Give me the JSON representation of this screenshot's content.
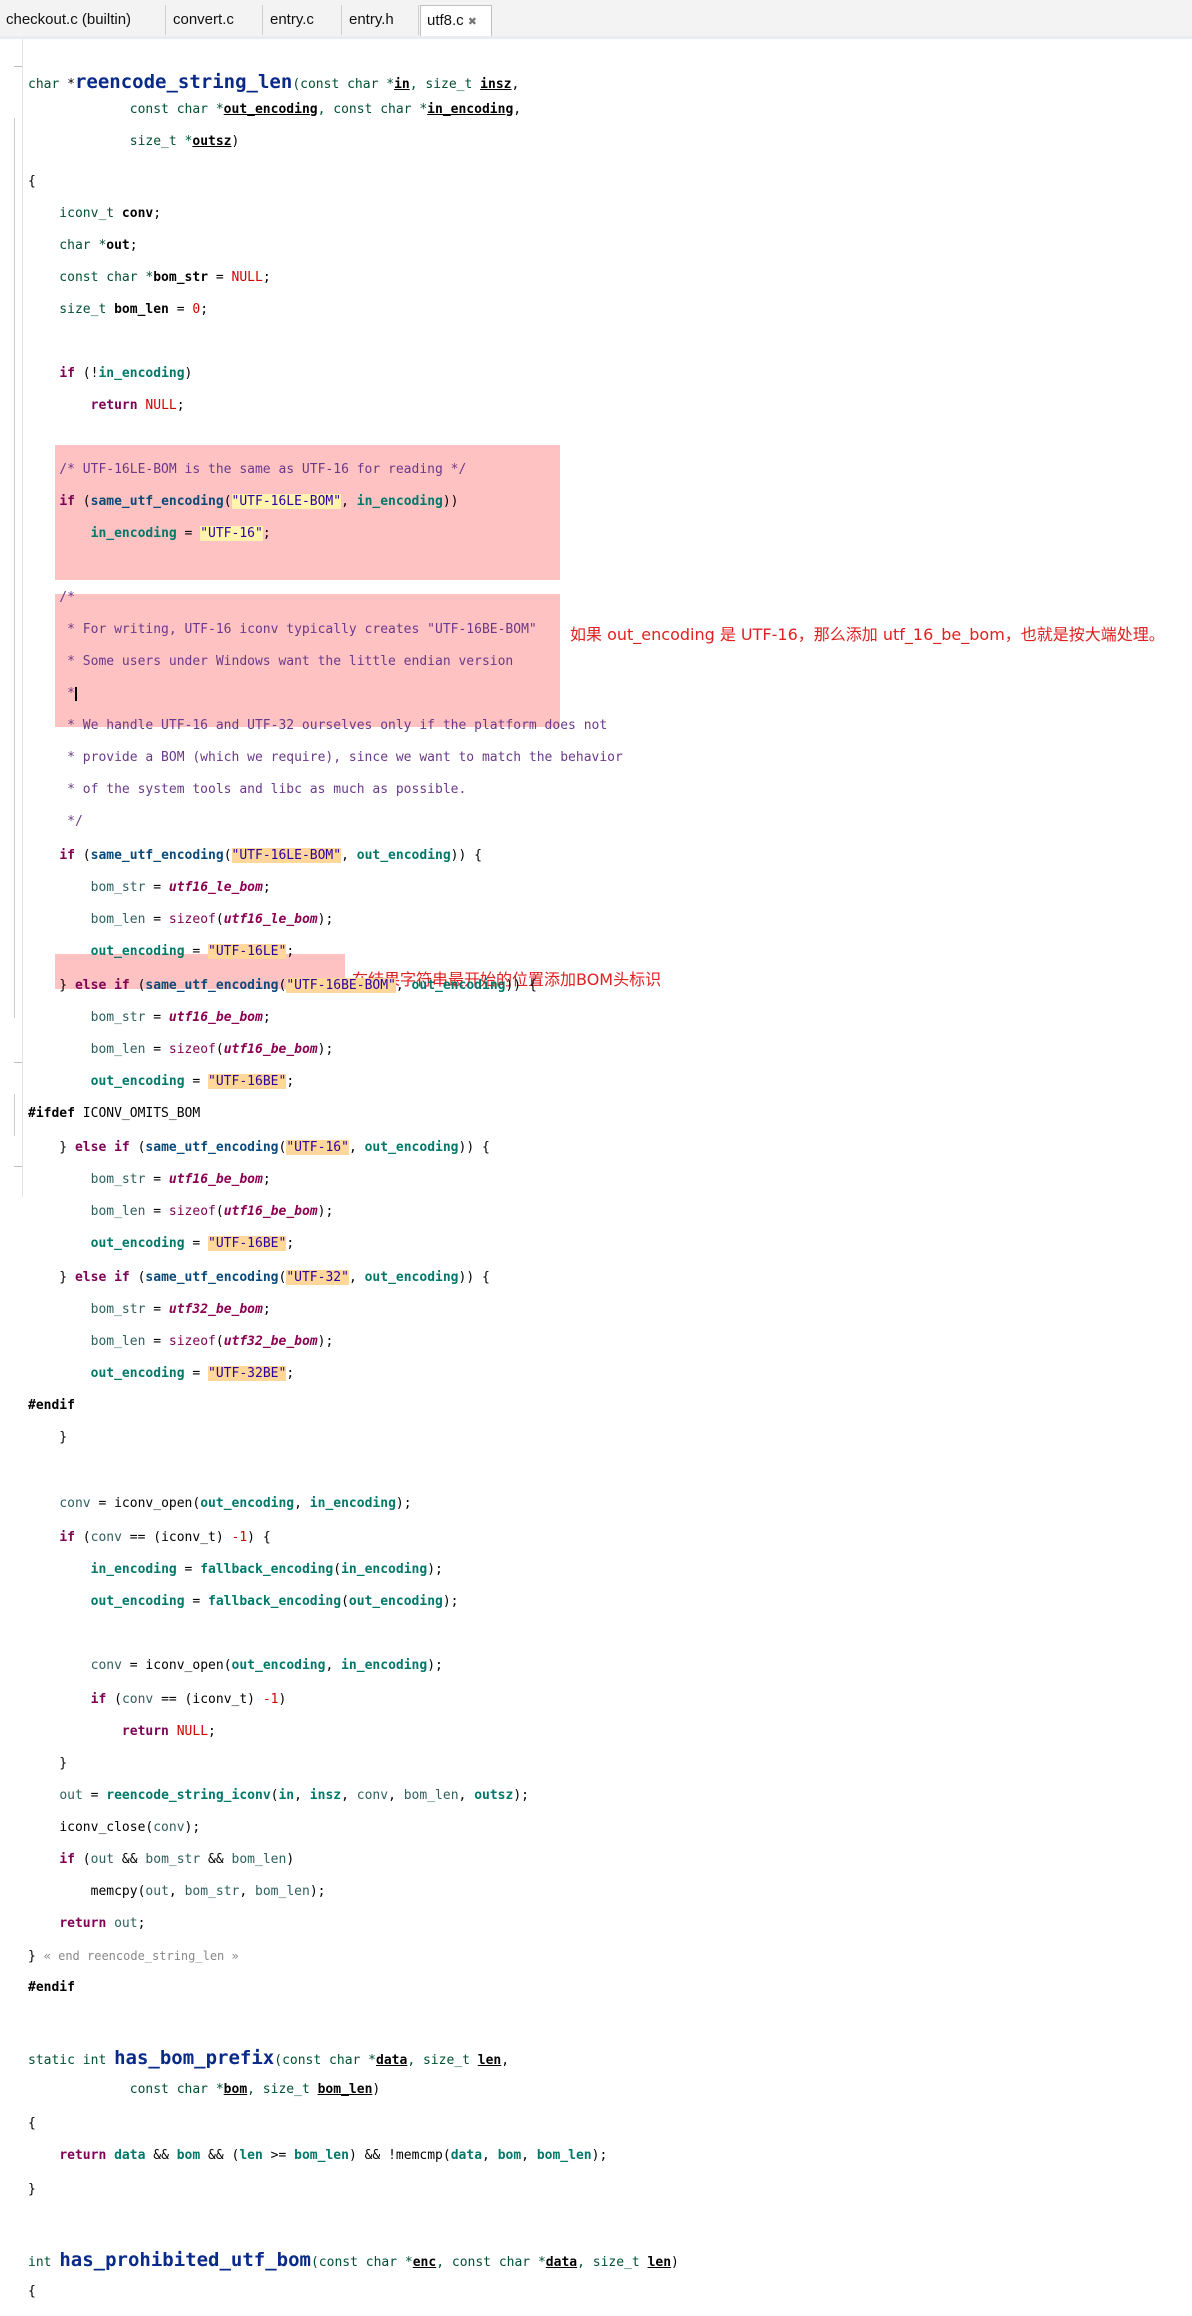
{
  "tabs": [
    {
      "label": "checkout.c (builtin)"
    },
    {
      "label": "convert.c"
    },
    {
      "label": "entry.c"
    },
    {
      "label": "entry.h"
    },
    {
      "label": "utf8.c",
      "close": "✖",
      "active": true
    }
  ],
  "annotations": {
    "utf16_note": "如果 out_encoding 是 UTF-16，那么添加 utf_16_be_bom，也就是按大端处理。",
    "bom_note": "在结果字符串最开始的位置添加BOM头标识"
  },
  "code": {
    "l1": [
      "char ",
      "*",
      "reencode_string_len",
      "(const char *",
      "in",
      ", size_t ",
      "insz",
      ","
    ],
    "l2": [
      "             const char *",
      "out_encoding",
      ", const char *",
      "in_encoding",
      ","
    ],
    "l3": [
      "             size_t *",
      "outsz",
      ")"
    ],
    "l4": "{",
    "l5": [
      "    iconv_t ",
      "conv",
      ";"
    ],
    "l6": [
      "    char *",
      "out",
      ";"
    ],
    "l7": [
      "    const char *",
      "bom_str",
      " = ",
      "NULL",
      ";"
    ],
    "l8": [
      "    size_t ",
      "bom_len",
      " = ",
      "0",
      ";"
    ],
    "l9": [
      "    ",
      "if",
      " (!",
      "in_encoding",
      ")"
    ],
    "l10": [
      "        ",
      "return",
      " ",
      "NULL",
      ";"
    ],
    "c1": "    /* UTF-16LE-BOM is the same as UTF-16 for reading */",
    "l11": [
      "    ",
      "if",
      " (",
      "same_utf_encoding",
      "(",
      "\"UTF-16LE-BOM\"",
      ", ",
      "in_encoding",
      "))"
    ],
    "l12": [
      "        ",
      "in_encoding",
      " = ",
      "\"UTF-16\"",
      ";"
    ],
    "c2": "    /*",
    "c3": "     * For writing, UTF-16 iconv typically creates \"UTF-16BE-BOM\"",
    "c4": "     * Some users under Windows want the little endian version",
    "c5": "     *",
    "c6": "     * We handle UTF-16 and UTF-32 ourselves only if the platform does not",
    "c7": "     * provide a BOM (which we require), since we want to match the behavior",
    "c8": "     * of the system tools and libc as much as possible.",
    "c9": "     */",
    "h1": [
      "    ",
      "if",
      " (",
      "same_utf_encoding",
      "(",
      "\"UTF-16LE-BOM\"",
      ", ",
      "out_encoding",
      ")) {"
    ],
    "h2": [
      "        ",
      "bom_str",
      " = ",
      "utf16_le_bom",
      ";"
    ],
    "h3": [
      "        ",
      "bom_len",
      " = ",
      "sizeof",
      "(",
      "utf16_le_bom",
      ");"
    ],
    "h4": [
      "        ",
      "out_encoding",
      " = ",
      "\"UTF-16LE\"",
      ";"
    ],
    "h5": [
      "    } ",
      "else if",
      " (",
      "same_utf_encoding",
      "(",
      "\"UTF-16BE-BOM\"",
      ", ",
      "out_encoding",
      ")) {"
    ],
    "h6": [
      "        ",
      "bom_str",
      " = ",
      "utf16_be_bom",
      ";"
    ],
    "h7": [
      "        ",
      "bom_len",
      " = ",
      "sizeof",
      "(",
      "utf16_be_bom",
      ");"
    ],
    "h8": [
      "        ",
      "out_encoding",
      " = ",
      "\"UTF-16BE\"",
      ";"
    ],
    "p1": [
      "#ifdef",
      " ICONV_OMITS_BOM"
    ],
    "h9": [
      "    } ",
      "else if",
      " (",
      "same_utf_encoding",
      "(",
      "\"UTF-16\"",
      ", ",
      "out_encoding",
      ")) {"
    ],
    "h10": [
      "        ",
      "bom_str",
      " = ",
      "utf16_be_bom",
      ";"
    ],
    "h11": [
      "        ",
      "bom_len",
      " = ",
      "sizeof",
      "(",
      "utf16_be_bom",
      ");"
    ],
    "h12": [
      "        ",
      "out_encoding",
      " = ",
      "\"UTF-16BE\"",
      ";"
    ],
    "h13": [
      "    } ",
      "else if",
      " (",
      "same_utf_encoding",
      "(",
      "\"UTF-32\"",
      ", ",
      "out_encoding",
      ")) {"
    ],
    "h14": [
      "        ",
      "bom_str",
      " = ",
      "utf32_be_bom",
      ";"
    ],
    "h15": [
      "        ",
      "bom_len",
      " = ",
      "sizeof",
      "(",
      "utf32_be_bom",
      ");"
    ],
    "h16": [
      "        ",
      "out_encoding",
      " = ",
      "\"UTF-32BE\"",
      ";"
    ],
    "p2": "#endif",
    "l13": "    }",
    "l14": [
      "    ",
      "conv",
      " = ",
      "iconv_open",
      "(",
      "out_encoding",
      ", ",
      "in_encoding",
      ");"
    ],
    "l15": [
      "    ",
      "if",
      " (",
      "conv",
      " == (iconv_t) ",
      "-1",
      ") {"
    ],
    "l16": [
      "        ",
      "in_encoding",
      " = ",
      "fallback_encoding",
      "(",
      "in_encoding",
      ");"
    ],
    "l17": [
      "        ",
      "out_encoding",
      " = ",
      "fallback_encoding",
      "(",
      "out_encoding",
      ");"
    ],
    "l18": [
      "        ",
      "conv",
      " = ",
      "iconv_open",
      "(",
      "out_encoding",
      ", ",
      "in_encoding",
      ");"
    ],
    "l19": [
      "        ",
      "if",
      " (",
      "conv",
      " == (iconv_t) ",
      "-1",
      ")"
    ],
    "l20": [
      "            ",
      "return",
      " ",
      "NULL",
      ";"
    ],
    "l21": "    }",
    "l22": [
      "    ",
      "out",
      " = ",
      "reencode_string_iconv",
      "(",
      "in",
      ", ",
      "insz",
      ", ",
      "conv",
      ", ",
      "bom_len",
      ", ",
      "outsz",
      ");"
    ],
    "l23": [
      "    ",
      "iconv_close",
      "(",
      "conv",
      ");"
    ],
    "b1": [
      "    ",
      "if",
      " (",
      "out",
      " && ",
      "bom_str",
      " && ",
      "bom_len",
      ")"
    ],
    "b2": [
      "        ",
      "memcpy",
      "(",
      "out",
      ", ",
      "bom_str",
      ", ",
      "bom_len",
      ");"
    ],
    "l24": [
      "    ",
      "return",
      " ",
      "out",
      ";"
    ],
    "l25": [
      "} ",
      "« end reencode_string_len »"
    ],
    "p3": "#endif",
    "m1": [
      "static int ",
      "has_bom_prefix",
      "(const char *",
      "data",
      ", size_t ",
      "len",
      ","
    ],
    "m2": [
      "             const char *",
      "bom",
      ", size_t ",
      "bom_len",
      ")"
    ],
    "m3": "{",
    "m4": [
      "    ",
      "return",
      " ",
      "data",
      " && ",
      "bom",
      " && (",
      "len",
      " >= ",
      "bom_len",
      ") && !",
      "memcmp",
      "(",
      "data",
      ", ",
      "bom",
      ", ",
      "bom_len",
      ");"
    ],
    "m5": "}",
    "n1": [
      "int ",
      "has_prohibited_utf_bom",
      "(const char *",
      "enc",
      ", const char *",
      "data",
      ", size_t ",
      "len",
      ")"
    ],
    "n2": "{"
  }
}
